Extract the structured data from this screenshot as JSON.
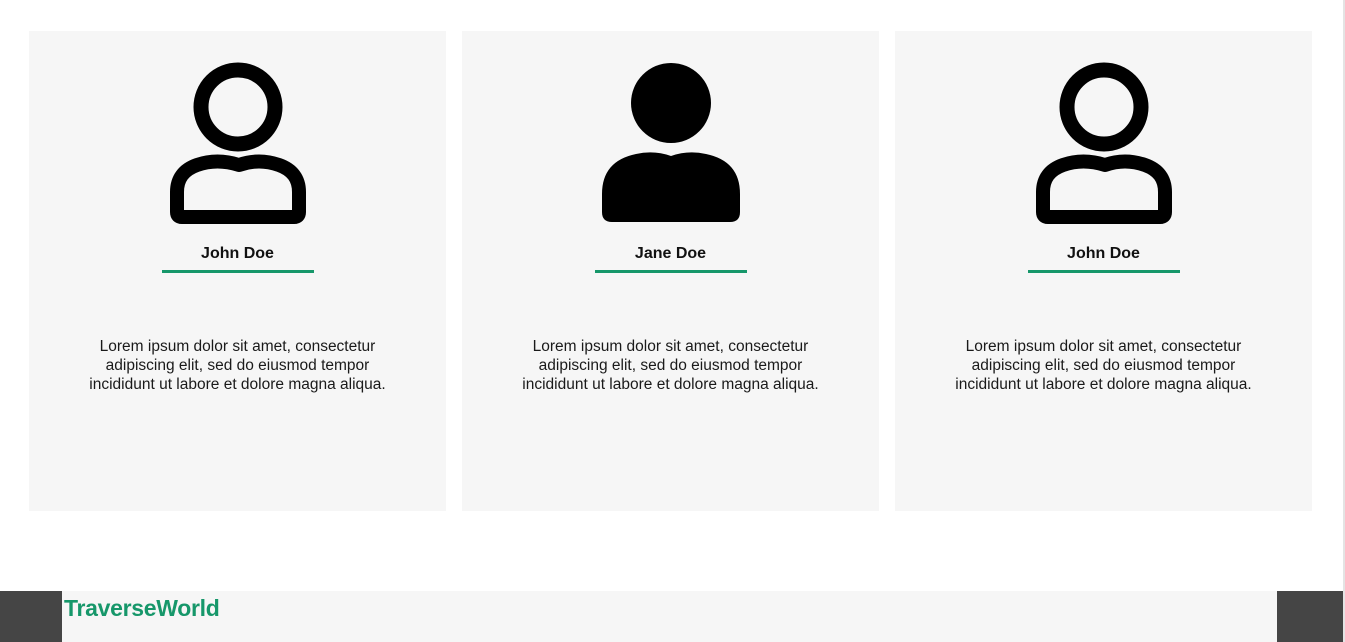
{
  "cards": [
    {
      "icon": "user-outline-icon",
      "name": "John Doe",
      "description": "Lorem ipsum dolor sit amet, consectetur adipiscing elit, sed do eiusmod tempor incididunt ut labore et dolore magna aliqua."
    },
    {
      "icon": "user-solid-icon",
      "name": "Jane Doe",
      "description": "Lorem ipsum dolor sit amet, consectetur adipiscing elit, sed do eiusmod tempor incididunt ut labore et dolore magna aliqua."
    },
    {
      "icon": "user-outline-icon",
      "name": "John Doe",
      "description": "Lorem ipsum dolor sit amet, consectetur adipiscing elit, sed do eiusmod tempor incididunt ut labore et dolore magna aliqua."
    }
  ],
  "footer": {
    "brand": "TraverseWorld"
  },
  "colors": {
    "accent": "#16976a",
    "card_bg": "#f6f6f6",
    "footer_side": "#454545"
  }
}
